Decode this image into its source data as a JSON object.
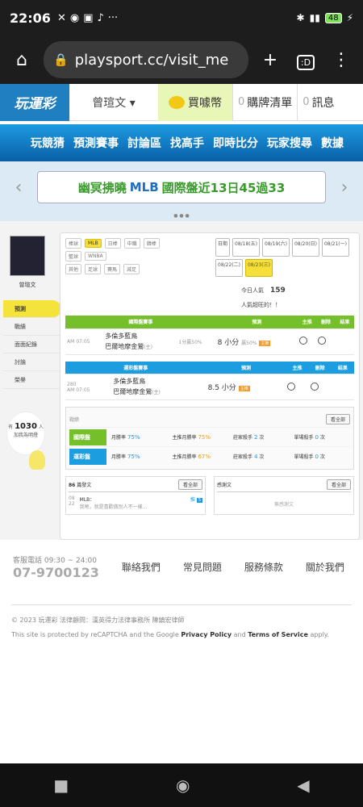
{
  "status": {
    "time": "22:06",
    "battery": "48"
  },
  "browser": {
    "url": "playsport.cc/visit_me",
    "tab_label": ":D"
  },
  "nav": {
    "logo": "玩運彩",
    "user": "曾瑄文",
    "coins_label": "買噱幣",
    "cart_count": "0",
    "cart_label": "購牌清單",
    "msg_count": "0",
    "msg_label": "訊息"
  },
  "menu": [
    "玩競猜",
    "預測賽事",
    "討論區",
    "找高手",
    "即時比分",
    "玩家搜尋",
    "數據"
  ],
  "banner": {
    "left": "幽冥拂曉",
    "mlb": "MLB",
    "right": "國際盤近13日45過33"
  },
  "profile": {
    "name": "曾瑄文",
    "side": [
      "預測",
      "戰績",
      "面面紀錄",
      "討論",
      "榮譽"
    ],
    "popular_prefix": "有",
    "popular_count": "1030",
    "popular_suffix": "人",
    "popular_note": "加我為明燈"
  },
  "filters": {
    "baseball_label": "棒球",
    "baseball_tags": [
      "MLB",
      "日棒",
      "中職",
      "韓棒"
    ],
    "basketball_label": "籃球",
    "basketball_tags": [
      "WNBA"
    ],
    "other_label": "其他",
    "other_tags": [
      "足球",
      "賽馬",
      "減足"
    ],
    "date_label": "日期",
    "dates": [
      "08/18(五)",
      "08/19(六)",
      "08/20(日)",
      "08/21(一)",
      "08/22(二)",
      "08/23(三)"
    ]
  },
  "hot": {
    "label": "今日人氣",
    "value": "159",
    "note": "人氣超旺的！！"
  },
  "intl": {
    "header": "國際盤賽事",
    "pred": "預測",
    "col_main": "主推",
    "col_del": "刪除",
    "col_res": "結果",
    "meta": "AM 07:05",
    "team1": "多倫多藍鳥",
    "team2": "巴爾地摩金鶯",
    "tag": "(主)",
    "line": "1分贏50%",
    "pick": "8 小分",
    "pickline": "贏50%",
    "badge": "主推"
  },
  "lottery": {
    "header": "運彩盤賽事",
    "pred": "預測",
    "col_main": "主推",
    "col_del": "刪除",
    "col_res": "結果",
    "num": "280",
    "meta": "AM 07:05",
    "team1": "多倫多藍鳥",
    "team2": "巴爾地摩金鶯",
    "tag": "(主)",
    "pick": "8.5 小分",
    "badge": "主推"
  },
  "perf": {
    "title": "戰績",
    "more": "看全部",
    "rows": [
      {
        "tag": "國際盤",
        "month_label": "月勝率",
        "month": "75",
        "main_label": "主推月勝率",
        "main": "75",
        "streak_label": "莊家殺手",
        "streak": "2",
        "single_label": "單場殺手",
        "single": "0"
      },
      {
        "tag": "運彩盤",
        "month_label": "月勝率",
        "month": "75",
        "main_label": "主推月勝率",
        "main": "67",
        "streak_label": "莊家殺手",
        "streak": "4",
        "single_label": "單場殺手",
        "single": "0"
      }
    ]
  },
  "posts": {
    "count": "86",
    "label": "篇發文",
    "more": "看全部",
    "date": "08",
    "sub": "22",
    "title": "MLB：",
    "text": "我吔，就是喜歡做別人不一樣...",
    "push": "推",
    "push_n": "5"
  },
  "thanks": {
    "label": "感謝文",
    "more": "看全部",
    "empty": "無感謝文"
  },
  "footer": {
    "svc": "客服電話 09:30 ~ 24:00",
    "tel": "07-9700123",
    "links": [
      "聯絡我們",
      "常見問題",
      "服務條款",
      "關於我們"
    ],
    "copy": "© 2023 玩運彩 法律顧問：漢英得力法律事務所 陳鎮宏律師",
    "captcha_pre": "This site is protected by reCAPTCHA and the Google ",
    "privacy": "Privacy Policy",
    "and": " and ",
    "terms": "Terms of Service",
    "apply": " apply."
  }
}
